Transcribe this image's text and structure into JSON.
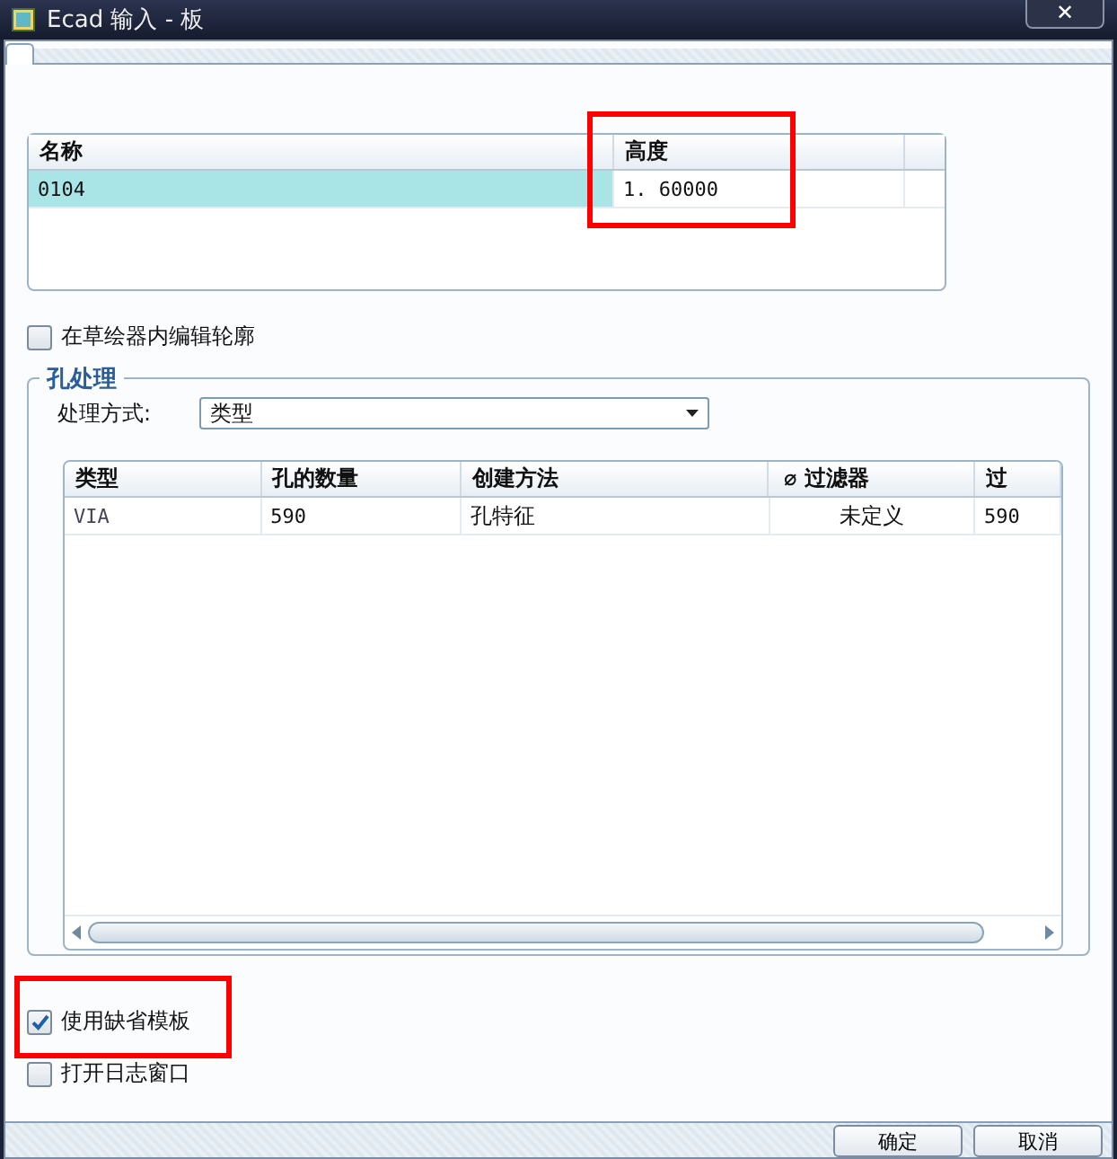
{
  "window": {
    "title": "Ecad 输入 - 板",
    "close": "✕"
  },
  "board_table": {
    "columns": [
      {
        "label": "名称",
        "highlighted": false
      },
      {
        "label": "高度",
        "highlighted": true
      }
    ],
    "rows": [
      {
        "cells": [
          "0104",
          "1. 60000"
        ],
        "selected": true
      }
    ]
  },
  "edit_in_sketcher": {
    "label": "在草绘器内编辑轮廓",
    "checked": false
  },
  "hole_group": {
    "title": "孔处理",
    "method_label": "处理方式:",
    "method_value": "类型",
    "columns": [
      "类型",
      "孔的数量",
      "创建方法",
      "⌀ 过滤器",
      "过"
    ],
    "rows": [
      [
        "VIA",
        "590",
        "孔特征",
        "未定义",
        "590"
      ]
    ]
  },
  "options": [
    {
      "label": "使用缺省模板",
      "checked": true,
      "highlighted": true
    },
    {
      "label": "打开日志窗口",
      "checked": false,
      "highlighted": false
    }
  ],
  "buttons": [
    "确定",
    "取消"
  ]
}
